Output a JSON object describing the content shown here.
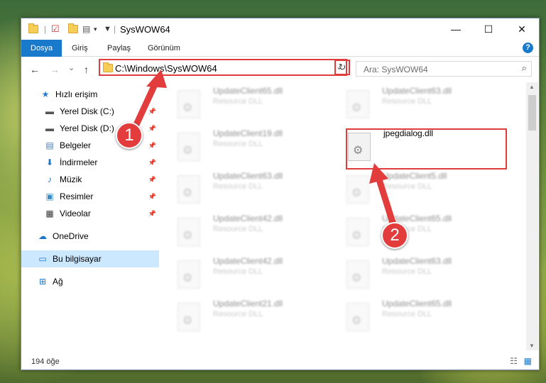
{
  "window": {
    "title": "SysWOW64",
    "minimize": "—",
    "maximize": "☐",
    "close": "✕"
  },
  "ribbon": {
    "tabs": [
      "Dosya",
      "Giriş",
      "Paylaş",
      "Görünüm"
    ],
    "help": "?"
  },
  "nav": {
    "back": "←",
    "forward": "→",
    "recent": "⌄",
    "up": "↑",
    "address": "C:\\Windows\\SysWOW64",
    "refresh": "↻",
    "search_placeholder": "Ara: SysWOW64"
  },
  "sidebar": {
    "items": [
      {
        "label": "Hızlı erişim",
        "icon": "star-icon"
      },
      {
        "label": "Yerel Disk (C:)",
        "icon": "drive-icon"
      },
      {
        "label": "Yerel Disk (D:)",
        "icon": "drive-icon"
      },
      {
        "label": "Belgeler",
        "icon": "document-icon"
      },
      {
        "label": "İndirmeler",
        "icon": "download-icon"
      },
      {
        "label": "Müzik",
        "icon": "music-icon"
      },
      {
        "label": "Resimler",
        "icon": "pictures-icon"
      },
      {
        "label": "Videolar",
        "icon": "video-icon"
      },
      {
        "label": "OneDrive",
        "icon": "cloud-icon"
      },
      {
        "label": "Bu bilgisayar",
        "icon": "computer-icon"
      },
      {
        "label": "Ağ",
        "icon": "network-icon"
      }
    ]
  },
  "files": [
    {
      "name": "UpdateClient65.dll",
      "desc": "Resource DLL"
    },
    {
      "name": "UpdateClient63.dll",
      "desc": "Resource DLL"
    },
    {
      "name": "UpdateClient19.dll",
      "desc": "Resource DLL"
    },
    {
      "name": "jpegdialog.dll",
      "desc": ""
    },
    {
      "name": "UpdateClient63.dll",
      "desc": "Resource DLL"
    },
    {
      "name": "UpdateClient5.dll",
      "desc": "Resource DLL"
    },
    {
      "name": "UpdateClient42.dll",
      "desc": "Resource DLL"
    },
    {
      "name": "UpdateClient65.dll",
      "desc": "Resource DLL"
    },
    {
      "name": "UpdateClient42.dll",
      "desc": "Resource DLL"
    },
    {
      "name": "UpdateClient63.dll",
      "desc": "Resource DLL"
    },
    {
      "name": "UpdateClient21.dll",
      "desc": "Resource DLL"
    },
    {
      "name": "UpdateClient65.dll",
      "desc": "Resource DLL"
    }
  ],
  "status": {
    "count": "194 öğe"
  },
  "annotations": {
    "badge1": "1",
    "badge2": "2"
  },
  "colors": {
    "accent": "#1979ca",
    "highlight": "#e13b3b"
  }
}
